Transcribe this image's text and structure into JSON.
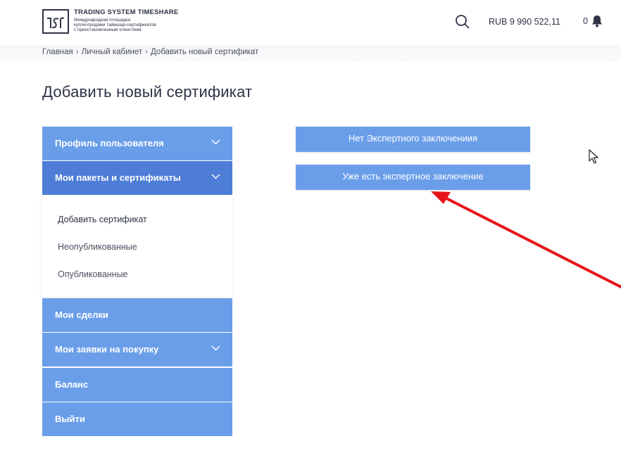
{
  "header": {
    "logo_title": "TRADING SYSTEM TIMESHARE",
    "logo_subtitle_lines": [
      "Международная площадка",
      "купли-продажи таймшар-сертификатов",
      "с приостановленным членством"
    ],
    "balance": "RUB 9 990 522,11",
    "notification_count": "0"
  },
  "breadcrumb": {
    "home": "Главная",
    "cabinet": "Личный кабинет",
    "current": "Добавить новый сертификат",
    "separator": "›"
  },
  "page_title": "Добавить новый сертификат",
  "sidebar": {
    "items": [
      {
        "label": "Профиль пользователя",
        "has_chevron": true
      },
      {
        "label": "Мои пакеты и сертификаты",
        "has_chevron": true,
        "expanded": true
      },
      {
        "label": "Мои сделки",
        "has_chevron": false
      },
      {
        "label": "Мои заявки на покупку",
        "has_chevron": true
      },
      {
        "label": "Баланс",
        "has_chevron": false
      },
      {
        "label": "Выйти",
        "has_chevron": false
      }
    ],
    "submenu": [
      {
        "label": "Добавить сертификат"
      },
      {
        "label": "Неопубликованные"
      },
      {
        "label": "Опубликованные"
      }
    ]
  },
  "main": {
    "buttons": [
      {
        "label": "Нет Экспертного заключениия"
      },
      {
        "label": "Уже есть экспертное заключение"
      }
    ]
  },
  "colors": {
    "menu_blue": "#6b9ee9",
    "menu_active": "#4d7dd6",
    "text_dark": "#2e3346",
    "annotation_red": "#e8141a"
  },
  "icons": [
    "logo-icon",
    "search-icon",
    "bell-icon",
    "chevron-down-icon",
    "cursor-icon",
    "annotation-arrow"
  ]
}
